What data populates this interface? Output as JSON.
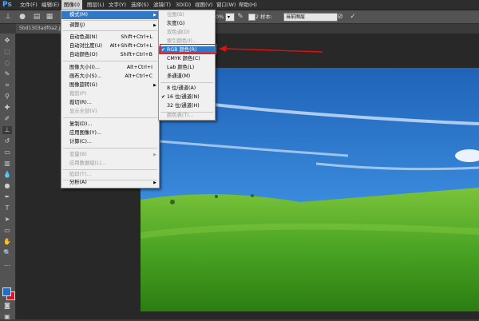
{
  "app": {
    "logo": "Ps"
  },
  "menubar": {
    "items": [
      "文件(F)",
      "编辑(E)",
      "图像(I)",
      "图层(L)",
      "文字(Y)",
      "选择(S)",
      "滤镜(T)",
      "3D(D)",
      "视图(V)",
      "窗口(W)",
      "帮助(H)"
    ]
  },
  "options": {
    "zoom_value": "0%",
    "all_layers_label": "对所有图层取样",
    "sample_prefix": "2",
    "sample_label": "样本:",
    "sample_value": "当前图层"
  },
  "document": {
    "tab_title": "5bd1303adf0a2.jp"
  },
  "image_menu": {
    "items": [
      {
        "label": "模式(M)",
        "shortcut": "",
        "submenu": true,
        "state": "highlight"
      },
      {
        "label": "调整(J)",
        "shortcut": "",
        "submenu": true,
        "state": "normal"
      },
      {
        "label": "自动色调(N)",
        "shortcut": "Shift+Ctrl+L",
        "submenu": false,
        "state": "normal"
      },
      {
        "label": "自动对比度(U)",
        "shortcut": "Alt+Shift+Ctrl+L",
        "submenu": false,
        "state": "normal"
      },
      {
        "label": "自动颜色(O)",
        "shortcut": "Shift+Ctrl+B",
        "submenu": false,
        "state": "normal"
      },
      {
        "label": "图像大小(I)...",
        "shortcut": "Alt+Ctrl+I",
        "submenu": false,
        "state": "normal"
      },
      {
        "label": "画布大小(S)...",
        "shortcut": "Alt+Ctrl+C",
        "submenu": false,
        "state": "normal"
      },
      {
        "label": "图像旋转(G)",
        "shortcut": "",
        "submenu": true,
        "state": "normal"
      },
      {
        "label": "裁剪(P)",
        "shortcut": "",
        "submenu": false,
        "state": "disabled"
      },
      {
        "label": "裁切(R)...",
        "shortcut": "",
        "submenu": false,
        "state": "normal"
      },
      {
        "label": "显示全部(V)",
        "shortcut": "",
        "submenu": false,
        "state": "disabled"
      },
      {
        "label": "复制(D)...",
        "shortcut": "",
        "submenu": false,
        "state": "normal"
      },
      {
        "label": "应用图像(Y)...",
        "shortcut": "",
        "submenu": false,
        "state": "normal"
      },
      {
        "label": "计算(C)...",
        "shortcut": "",
        "submenu": false,
        "state": "normal"
      },
      {
        "label": "变量(B)",
        "shortcut": "",
        "submenu": true,
        "state": "disabled"
      },
      {
        "label": "应用数据组(L)...",
        "shortcut": "",
        "submenu": false,
        "state": "disabled"
      },
      {
        "label": "陷印(T)...",
        "shortcut": "",
        "submenu": false,
        "state": "disabled"
      },
      {
        "label": "分析(A)",
        "shortcut": "",
        "submenu": true,
        "state": "normal"
      }
    ]
  },
  "mode_submenu": {
    "items": [
      {
        "label": "位图(B)",
        "checked": false,
        "state": "disabled"
      },
      {
        "label": "灰度(G)",
        "checked": false,
        "state": "normal"
      },
      {
        "label": "双色调(D)",
        "checked": false,
        "state": "disabled"
      },
      {
        "label": "索引颜色(I)...",
        "checked": false,
        "state": "disabled"
      },
      {
        "label": "RGB 颜色(R)",
        "checked": true,
        "state": "highlight"
      },
      {
        "label": "CMYK 颜色(C)",
        "checked": false,
        "state": "normal"
      },
      {
        "label": "Lab 颜色(L)",
        "checked": false,
        "state": "normal"
      },
      {
        "label": "多通道(M)",
        "checked": false,
        "state": "normal"
      },
      {
        "label": "8 位/通道(A)",
        "checked": false,
        "state": "normal"
      },
      {
        "label": "16 位/通道(N)",
        "checked": true,
        "state": "normal"
      },
      {
        "label": "32 位/通道(H)",
        "checked": false,
        "state": "normal"
      },
      {
        "label": "颜色表(T)...",
        "checked": false,
        "state": "disabled"
      }
    ]
  },
  "colors": {
    "highlight": "#3178c6",
    "annotation": "#e01010",
    "foreground": "#1e6fc9",
    "background": "#e0141e"
  }
}
